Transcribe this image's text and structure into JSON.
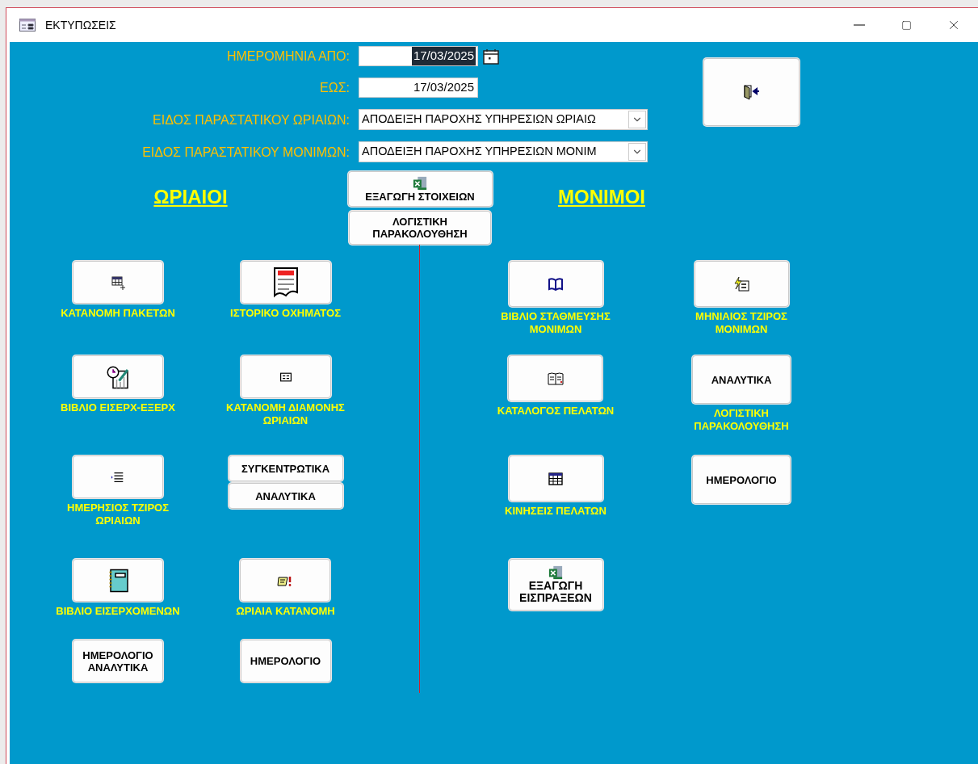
{
  "window": {
    "title": "ΕΚΤΥΠΩΣΕΙΣ"
  },
  "filters": [
    {
      "kind": "date",
      "label": "ΗΜΕΡΟΜΗΝΙΑ ΑΠΟ:",
      "value": "17/03/2025",
      "highlighted": true,
      "picker": true
    },
    {
      "kind": "date",
      "label": "ΕΩΣ:",
      "value": "17/03/2025",
      "highlighted": false,
      "picker": false
    },
    {
      "kind": "combo",
      "label": "ΕΙΔΟΣ ΠΑΡΑΣΤΑΤΙΚΟΥ ΩΡΙΑΙΩΝ:",
      "value": "ΑΠΟΔΕΙΞΗ ΠΑΡΟΧΗΣ ΥΠΗΡΕΣΙΩΝ ΩΡΙΑΙΩ"
    },
    {
      "kind": "combo",
      "label": "ΕΙΔΟΣ ΠΑΡΑΣΤΑΤΙΚΟΥ ΜΟΝΙΜΩΝ:",
      "value": "ΑΠΟΔΕΙΞΗ ΠΑΡΟΧΗΣ ΥΠΗΡΕΣΙΩΝ ΜΟΝΙΜ"
    }
  ],
  "center": [
    {
      "kind": "excel",
      "label": "ΕΞΑΓΩΓΗ ΣΤΟΙΧΕΙΩΝ"
    },
    {
      "kind": "text",
      "label": "ΛΟΓΙΣΤΙΚΗ ΠΑΡΑΚΟΛΟΥΘΗΣΗ"
    }
  ],
  "hourly": {
    "heading": "ΩΡΙΑΙΟΙ",
    "columns": [
      {
        "items": [
          {
            "kind": "icon",
            "caption": "ΚΑΤΑΝΟΜΗ ΠΑΚΕΤΩΝ"
          },
          {
            "kind": "icon",
            "caption": "ΒΙΒΛΙΟ ΕΙΣΕΡΧ-ΕΞΕΡΧ"
          },
          {
            "kind": "icon",
            "caption": "ΗΜΕΡΗΣΙΟΣ ΤΖΙΡΟΣ ΩΡΙΑΙΩΝ"
          },
          {
            "kind": "icon",
            "caption": "ΒΙΒΛΙΟ ΕΙΣΕΡΧΟΜΕΝΩΝ"
          },
          {
            "kind": "text",
            "label": "ΗΜΕΡΟΛΟΓΙΟ ΑΝΑΛΥΤΙΚΑ"
          }
        ]
      },
      {
        "items": [
          {
            "kind": "icon",
            "caption": "ΙΣΤΟΡΙΚΟ ΟΧΗΜΑΤΟΣ"
          },
          {
            "kind": "icon",
            "caption": "ΚΑΤΑΝΟΜΗ ΔΙΑΜΟΝΗΣ ΩΡΙΑΙΩΝ"
          },
          {
            "kind": "stack",
            "labels": [
              "ΣΥΓΚΕΝΤΡΩΤΙΚΑ",
              "ΑΝΑΛΥΤΙΚΑ"
            ]
          },
          {
            "kind": "icon",
            "caption": "ΩΡΙΑΙΑ ΚΑΤΑΝΟΜΗ"
          },
          {
            "kind": "text",
            "label": "ΗΜΕΡΟΛΟΓΙΟ"
          }
        ]
      }
    ]
  },
  "permanent": {
    "heading": "ΜΟΝΙΜΟΙ",
    "columns": [
      {
        "items": [
          {
            "kind": "icon",
            "caption": "ΒΙΒΛΙΟ ΣΤΑΘΜΕΥΣΗΣ ΜΟΝΙΜΩΝ"
          },
          {
            "kind": "icon",
            "caption": "ΚΑΤΑΛΟΓΟΣ ΠΕΛΑΤΩΝ"
          },
          {
            "kind": "icon",
            "caption": "ΚΙΝΗΣΕΙΣ ΠΕΛΑΤΩΝ"
          },
          {
            "kind": "excel",
            "label": "ΕΞΑΓΩΓΗ ΕΙΣΠΡΑΞΕΩΝ"
          }
        ]
      },
      {
        "items": [
          {
            "kind": "icon",
            "caption": "ΜΗΝΙΑΙΟΣ ΤΖΙΡΟΣ ΜΟΝΙΜΩΝ"
          },
          {
            "kind": "text",
            "label": "ΑΝΑΛΥΤΙΚΑ",
            "caption": "ΛΟΓΙΣΤΙΚΗ ΠΑΡΑΚΟΛΟΥΘΗΣΗ"
          },
          {
            "kind": "text",
            "label": "ΗΜΕΡΟΛΟΓΙΟ"
          }
        ]
      }
    ]
  }
}
